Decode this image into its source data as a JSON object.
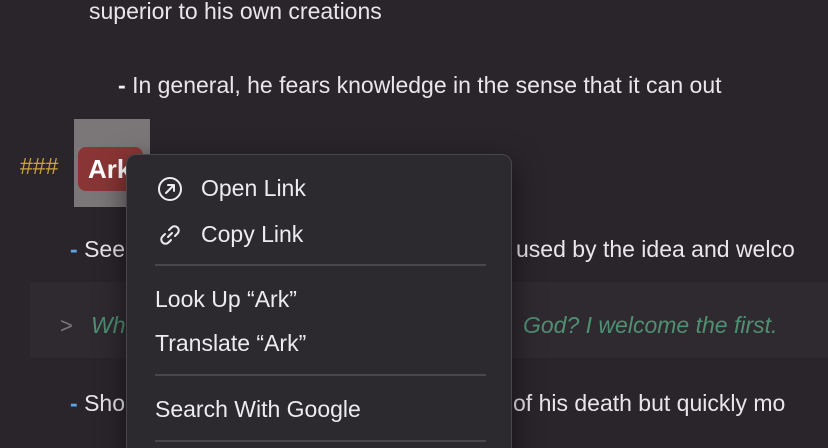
{
  "document": {
    "line1": "superior to his own creations",
    "line2_bullet": "-",
    "line2_text": "In general, he fears knowledge in the sense that it can out",
    "heading_hashes": "###",
    "heading_text": "Ark",
    "bullet1_mark": "-",
    "bullet1_start": "See",
    "bullet1_end": "used by the idea and welco",
    "quote_marker": ">",
    "quote_start": "Wh",
    "quote_end": "God? I welcome the first.",
    "bullet2_mark": "-",
    "bullet2_start": "Sho",
    "bullet2_end": "of his death but quickly mo"
  },
  "context_menu": {
    "open_link": "Open Link",
    "copy_link": "Copy Link",
    "look_up": "Look Up “Ark”",
    "translate": "Translate “Ark”",
    "search_google": "Search With Google",
    "icons": {
      "open_link": "arrow-up-right-circle-icon",
      "copy_link": "link-icon"
    }
  },
  "colors": {
    "background": "#2a252b",
    "heading_hash": "#c9a33c",
    "heading_pill": "#8a3535",
    "bullet": "#5aa6e8",
    "quote_text": "#4f8f72",
    "menu_background": "#2c2a2f"
  }
}
